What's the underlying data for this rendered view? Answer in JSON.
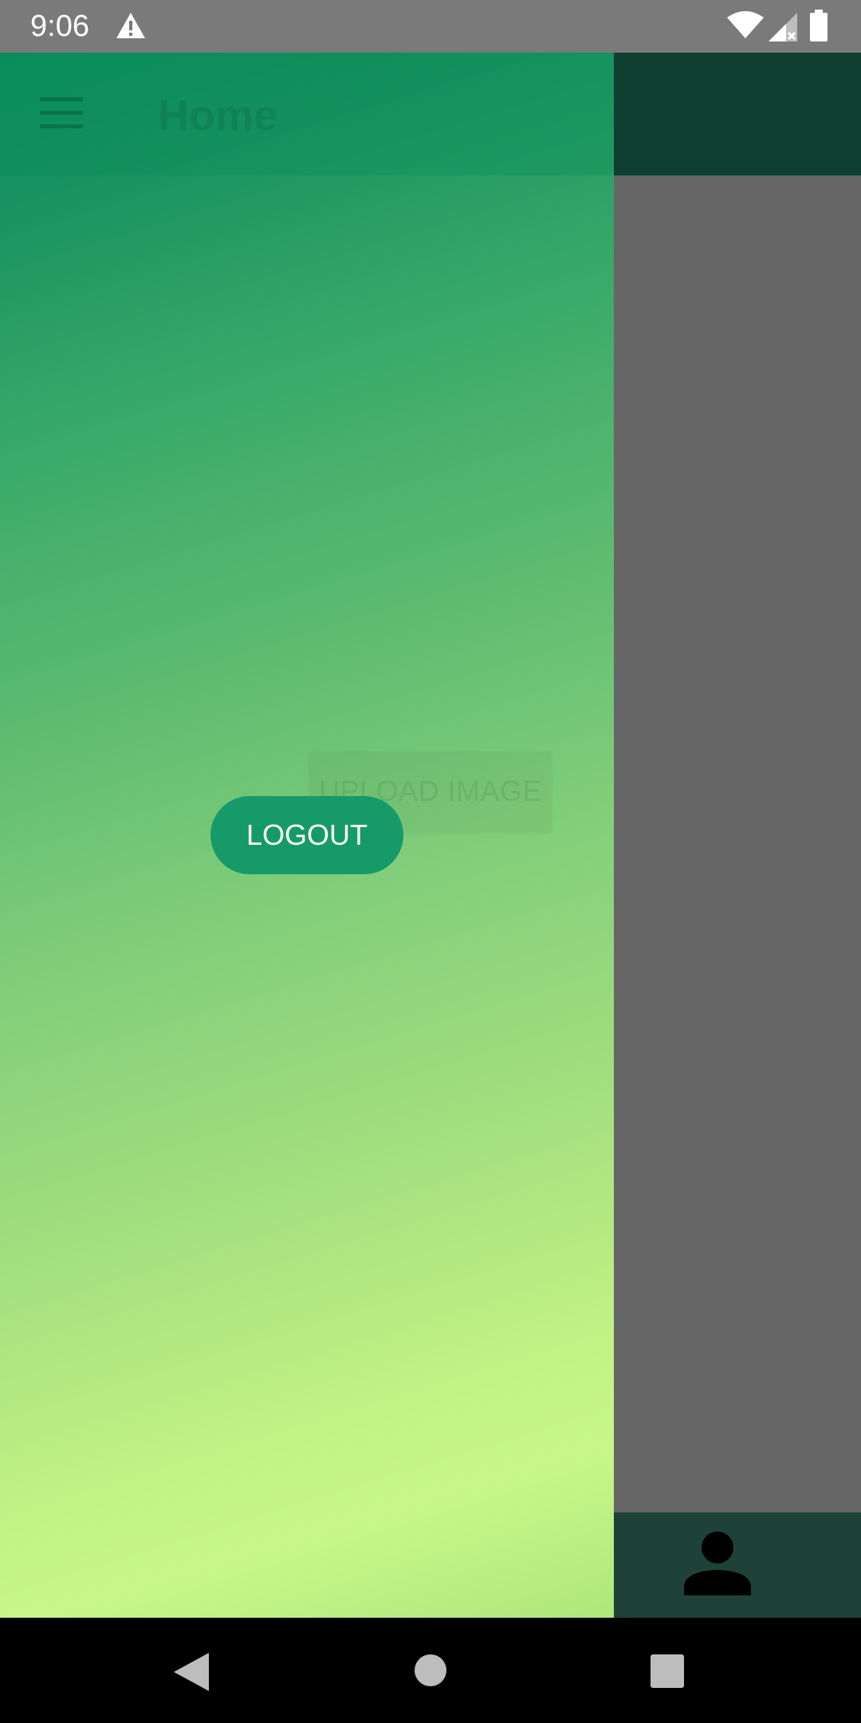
{
  "status_bar": {
    "time": "9:06",
    "icons": [
      "warning-icon",
      "wifi-icon",
      "cellular-signal-icon",
      "battery-icon"
    ]
  },
  "app": {
    "toolbar_title": "Home",
    "upload_button_label": "UPLOAD IMAGE",
    "bottom_nav_icon": "person-icon"
  },
  "drawer": {
    "logout_label": "LOGOUT"
  },
  "nav_bar": {
    "icons": [
      "back-icon",
      "home-icon",
      "recents-icon"
    ]
  },
  "colors": {
    "drawer_gradient_top": "#0a8e5e",
    "drawer_gradient_bottom": "#c8f788",
    "logout_button": "#169a6a",
    "toolbar": "#0f3f31",
    "bottom_nav": "#1e4237",
    "scrim": "#666666"
  }
}
